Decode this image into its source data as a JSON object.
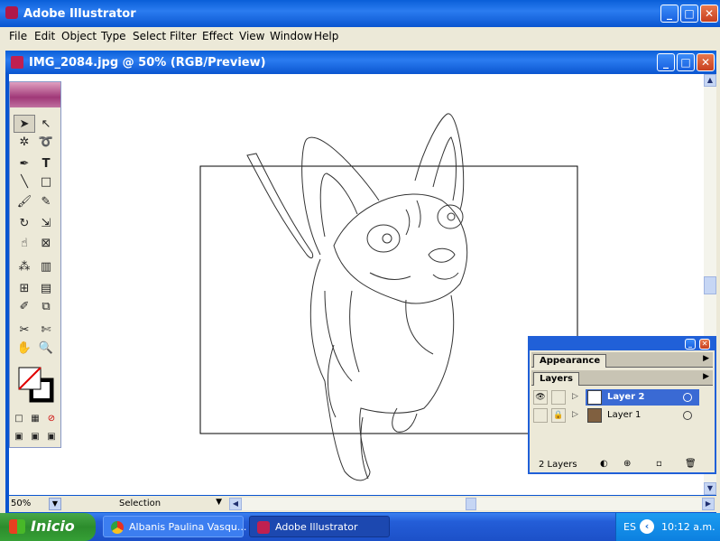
{
  "app": {
    "title": "Adobe Illustrator"
  },
  "window_buttons": {
    "minimize": "_",
    "maximize": "□",
    "close": "✕"
  },
  "menu": [
    "File",
    "Edit",
    "Object",
    "Type",
    "Select",
    "Filter",
    "Effect",
    "View",
    "Window",
    "Help"
  ],
  "document": {
    "title": "IMG_2084.jpg @ 50% (RGB/Preview)"
  },
  "status": {
    "zoom": "50%",
    "tool": "Selection"
  },
  "toolbox": {
    "tools": [
      "selection-tool",
      "direct-selection-tool",
      "magic-wand-tool",
      "lasso-tool",
      "pen-tool",
      "type-tool",
      "line-segment-tool",
      "rectangle-tool",
      "paintbrush-tool",
      "pencil-tool",
      "rotate-tool",
      "scale-tool",
      "warp-tool",
      "free-transform-tool",
      "symbol-sprayer-tool",
      "column-graph-tool",
      "mesh-tool",
      "gradient-tool",
      "eyedropper-tool",
      "blend-tool",
      "slice-tool",
      "scissors-tool",
      "hand-tool",
      "zoom-tool"
    ],
    "fill_color": "#ffffff",
    "stroke_color": "#000000"
  },
  "panels": {
    "appearance_tab": "Appearance",
    "layers_tab": "Layers",
    "layers": [
      {
        "name": "Layer 2",
        "selected": true
      },
      {
        "name": "Layer 1",
        "selected": false
      }
    ],
    "count": "2 Layers"
  },
  "taskbar": {
    "start": "Inicio",
    "tasks": [
      {
        "label": "Albanis Paulina Vasqu...",
        "icon": "chrome-icon"
      },
      {
        "label": "Adobe Illustrator",
        "icon": "illustrator-icon"
      }
    ],
    "lang": "ES",
    "clock": "10:12 a.m."
  },
  "colors": {
    "titlebar": "#0a5fd8",
    "start": "#2c8c2c",
    "layer_select": "#3a6ad4"
  }
}
